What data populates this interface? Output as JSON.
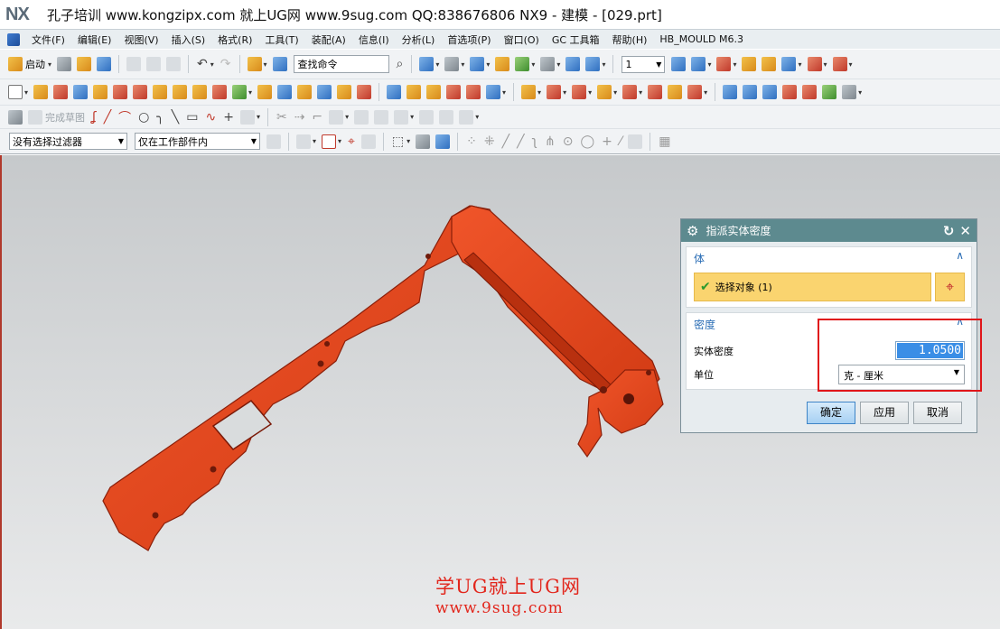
{
  "window": {
    "logo": "NX",
    "title": "孔子培训 www.kongzipx.com 就上UG网 www.9sug.com QQ:838676806 NX9 - 建模 - [029.prt]"
  },
  "menu": [
    "文件(F)",
    "编辑(E)",
    "视图(V)",
    "插入(S)",
    "格式(R)",
    "工具(T)",
    "装配(A)",
    "信息(I)",
    "分析(L)",
    "首选项(P)",
    "窗口(O)",
    "GC 工具箱",
    "帮助(H)",
    "HB_MOULD M6.3"
  ],
  "toolbar": {
    "start_label": "启动",
    "command_search": "查找命令",
    "layer_value": "1",
    "finish_sketch": "完成草图",
    "selection_filter": "没有选择过滤器",
    "scope_filter": "仅在工作部件内"
  },
  "dialog": {
    "title": "指派实体密度",
    "section_body": "体",
    "select_object": "选择对象 (1)",
    "section_density": "密度",
    "density_label": "实体密度",
    "density_value": "1.0500",
    "unit_label": "单位",
    "unit_value": "克 - 厘米",
    "ok": "确定",
    "apply": "应用",
    "cancel": "取消"
  },
  "watermark": {
    "line1": "学UG就上UG网",
    "line2": "www.9sug.com"
  },
  "colors": {
    "model": "#e8401c",
    "dialog_header": "#5d8a8f",
    "selection_row": "#fad46f",
    "highlight_box": "#e0161a",
    "watermark": "#e2261c"
  }
}
